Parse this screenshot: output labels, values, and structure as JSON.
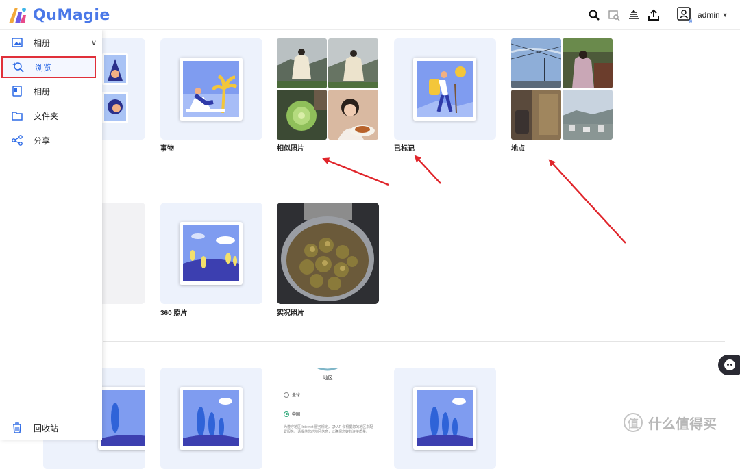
{
  "app": {
    "name": "QuMagie"
  },
  "header": {
    "user": "admin"
  },
  "sidebar": {
    "items": [
      {
        "label": "相册",
        "icon": "photo-album-icon",
        "expanded": true
      },
      {
        "label": "浏览",
        "icon": "browse-magic-icon",
        "active": true
      },
      {
        "label": "相册",
        "icon": "album-book-icon"
      },
      {
        "label": "文件夹",
        "icon": "folder-icon"
      },
      {
        "label": "分享",
        "icon": "share-icon"
      }
    ],
    "bottom": {
      "label": "回收站",
      "icon": "trash-icon"
    }
  },
  "sections": {
    "row1": [
      "事物",
      "相似照片",
      "已标记",
      "地点"
    ],
    "row2": [
      "360 照片",
      "实况照片"
    ]
  },
  "region_dialog": {
    "title": "地区",
    "options": [
      "全球",
      "中国"
    ],
    "selected": "中国",
    "note": "为遵守地区 Internet 服务规定，QNAP 会根据您的地区来配置服务。请提供您的地区信息，以确保您好的连接质量。"
  },
  "watermark": {
    "text": "什么值得买"
  },
  "colors": {
    "accent": "#2e6be6",
    "highlight": "#e0303a",
    "card_bg": "#edf2fc"
  }
}
